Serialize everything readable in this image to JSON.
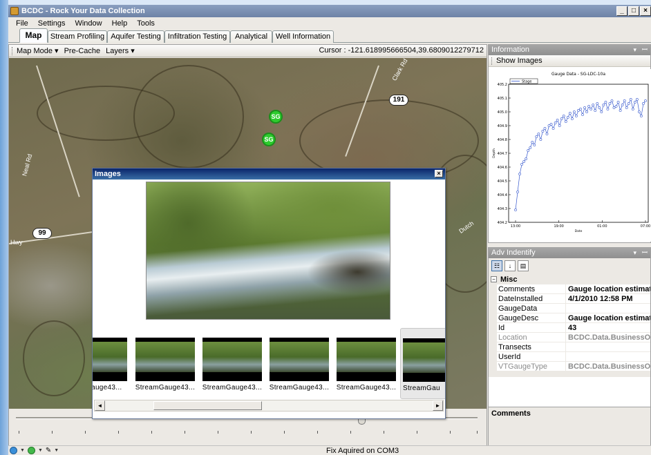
{
  "window": {
    "title": "BCDC - Rock Your Data Collection",
    "minimize": "_",
    "maximize": "□",
    "close": "×"
  },
  "menu": [
    "File",
    "Settings",
    "Window",
    "Help",
    "Tools"
  ],
  "tabs": [
    "Map",
    "Stream Profiling",
    "Aquifer Testing",
    "Infiltration Testing",
    "Analytical",
    "Well Information"
  ],
  "map_toolbar": {
    "map_mode": "Map Mode ▾",
    "pre_cache": "Pre-Cache",
    "layers": "Layers ▾",
    "cursor": "Cursor : -121.618995666504,39.6809012279712"
  },
  "map": {
    "shields": [
      "191",
      "99"
    ],
    "markers": [
      "SG",
      "SG"
    ],
    "labels": [
      "Hwy",
      "Neal Rd",
      "Clark Rd",
      "Dutch"
    ]
  },
  "images_dialog": {
    "title": "Images",
    "close": "×",
    "thumbnails": [
      "Gauge43...",
      "StreamGauge43...",
      "StreamGauge43...",
      "StreamGauge43...",
      "StreamGauge43...",
      "StreamGau"
    ],
    "scroll_left": "◄",
    "scroll_right": "►"
  },
  "info_panel": {
    "title": "Information",
    "dropdown": "▾",
    "pin": "ꟷ",
    "show_images": "Show Images"
  },
  "chart_data": {
    "type": "line",
    "title": "Gauge Data - SG-LDC-10a",
    "legend": [
      "Stage"
    ],
    "xlabel": "Date",
    "ylabel": "Depth",
    "x_ticks": [
      "13:00",
      "19:00",
      "01:00",
      "07:00"
    ],
    "y_ticks": [
      "404.2",
      "404.3",
      "404.4",
      "404.5",
      "404.6",
      "404.7",
      "404.8",
      "404.9",
      "405.0",
      "405.1",
      "405.2"
    ],
    "ylim": [
      404.2,
      405.2
    ],
    "series": [
      {
        "name": "Stage",
        "x": [
          0.0,
          0.3,
          0.6,
          0.9,
          1.2,
          1.5,
          1.8,
          2.1,
          2.4,
          2.7,
          3.0,
          3.3,
          3.6,
          3.9,
          4.2,
          4.5,
          4.8,
          5.1,
          5.4,
          5.7,
          6.0,
          6.3,
          6.6,
          6.9,
          7.2,
          7.5,
          7.8,
          8.1,
          8.4,
          8.7,
          9.0,
          9.3,
          9.6,
          9.9,
          10.2,
          10.5,
          10.8,
          11.1,
          11.4,
          11.7,
          12.0,
          12.3,
          12.6,
          12.9,
          13.2,
          13.5,
          13.8,
          14.1,
          14.4,
          14.7,
          15.0,
          15.3,
          15.6,
          15.9,
          16.2,
          16.5,
          16.8,
          17.1,
          17.4,
          17.7,
          18.0,
          18.3,
          18.6
        ],
        "values": [
          404.29,
          404.42,
          404.55,
          404.62,
          404.64,
          404.66,
          404.72,
          404.74,
          404.78,
          404.76,
          404.82,
          404.84,
          404.8,
          404.86,
          404.88,
          404.84,
          404.9,
          404.91,
          404.88,
          404.92,
          404.94,
          404.9,
          404.95,
          404.97,
          404.93,
          404.96,
          404.99,
          404.95,
          405.0,
          404.97,
          405.01,
          405.02,
          404.98,
          405.03,
          405.0,
          405.04,
          405.02,
          405.05,
          405.01,
          405.06,
          405.03,
          405.0,
          405.05,
          405.07,
          405.02,
          405.06,
          405.08,
          405.03,
          405.04,
          405.07,
          405.01,
          405.05,
          405.08,
          405.03,
          405.06,
          405.09,
          405.02,
          405.07,
          405.09,
          405.0,
          404.97,
          405.06,
          405.08
        ]
      }
    ]
  },
  "adv_identify": {
    "title": "Adv Indentify",
    "dropdown": "▾",
    "pin": "ꟷ",
    "category": "Misc",
    "collapse": "−",
    "rows": [
      {
        "key": "Comments",
        "value": "Gauge location estimated",
        "readonly": false
      },
      {
        "key": "DateInstalled",
        "value": "4/1/2010 12:58 PM",
        "readonly": false
      },
      {
        "key": "GaugeData",
        "value": "",
        "readonly": false
      },
      {
        "key": "GaugeDesc",
        "value": "Gauge location estimated",
        "readonly": false
      },
      {
        "key": "Id",
        "value": "43",
        "readonly": false
      },
      {
        "key": "Location",
        "value": "BCDC.Data.BusinessObjects",
        "readonly": true
      },
      {
        "key": "Transects",
        "value": "",
        "readonly": false
      },
      {
        "key": "UserId",
        "value": "",
        "readonly": false
      },
      {
        "key": "VTGaugeType",
        "value": "BCDC.Data.BusinessObjects",
        "readonly": true
      }
    ],
    "comments_label": "Comments"
  },
  "status": {
    "message": "Fix Aquired on COM3"
  }
}
